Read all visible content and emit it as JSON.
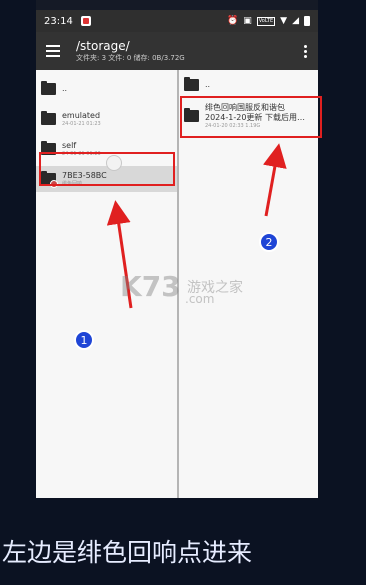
{
  "status_bar": {
    "time": "23:14",
    "volte": "VoLTE"
  },
  "app_bar": {
    "path": "/storage/",
    "info": "文件夹: 3  文件: 0   储存: 0B/3.72G"
  },
  "left_pane": {
    "items": [
      {
        "name": "..",
        "meta": ""
      },
      {
        "name": "emulated",
        "meta": "24-01-21 01:23"
      },
      {
        "name": "self",
        "meta": "24-01-21 01:23"
      },
      {
        "name": "7BE3-58BC",
        "meta": "绯色回响"
      }
    ]
  },
  "right_pane": {
    "items": [
      {
        "name": "..",
        "meta": ""
      },
      {
        "name": "绯色回响国服反和谐包",
        "name2": "2024-1-20更新 下载后用…",
        "meta": "24-01-20 02:33  1.19G"
      }
    ]
  },
  "annotations": {
    "n1": "1",
    "n2": "2"
  },
  "watermark": {
    "logo": "K73",
    "site": "游戏之家",
    "domain": ".com"
  },
  "caption": "左边是绯色回响点进来",
  "colors": {
    "highlight_red": "#e02020",
    "annotation_blue": "#1f45d6"
  }
}
